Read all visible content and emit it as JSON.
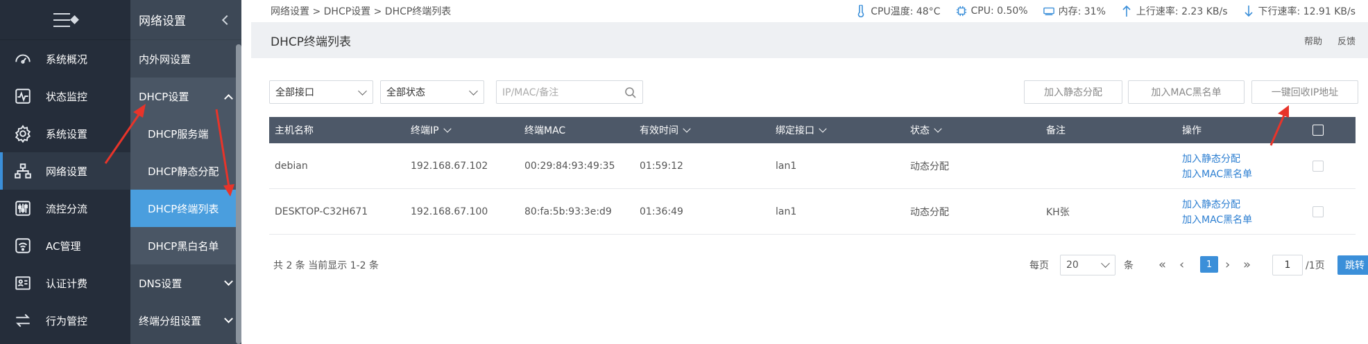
{
  "sidebar": {
    "items": [
      {
        "label": "系统概况",
        "icon": "dashboard-icon"
      },
      {
        "label": "状态监控",
        "icon": "pulse-icon"
      },
      {
        "label": "系统设置",
        "icon": "gear-icon"
      },
      {
        "label": "网络设置",
        "icon": "network-icon"
      },
      {
        "label": "流控分流",
        "icon": "sliders-icon"
      },
      {
        "label": "AC管理",
        "icon": "wifi-icon"
      },
      {
        "label": "认证计费",
        "icon": "id-card-icon"
      },
      {
        "label": "行为管控",
        "icon": "arrows-icon"
      }
    ]
  },
  "subnav": {
    "title": "网络设置",
    "items": [
      "内外网设置",
      "DHCP设置",
      "DNS设置",
      "终端分组设置"
    ],
    "children": [
      "DHCP服务端",
      "DHCP静态分配",
      "DHCP终端列表",
      "DHCP黑白名单"
    ]
  },
  "breadcrumb": "网络设置 > DHCP设置 > DHCP终端列表",
  "stats": {
    "cpu_temp": "CPU温度: 48°C",
    "cpu": "CPU: 0.50%",
    "mem": "内存: 31%",
    "up": "上行速率: 2.23 KB/s",
    "down": "下行速率: 12.91 KB/s"
  },
  "page": {
    "title": "DHCP终端列表",
    "help": "帮助",
    "feedback": "反馈"
  },
  "filters": {
    "iface": "全部接口",
    "status": "全部状态",
    "search_placeholder": "IP/MAC/备注"
  },
  "buttons": {
    "static": "加入静态分配",
    "blacklist": "加入MAC黑名单",
    "reclaim": "一键回收IP地址"
  },
  "table": {
    "headers": [
      "主机名称",
      "终端IP",
      "终端MAC",
      "有效时间",
      "绑定接口",
      "状态",
      "备注",
      "操作"
    ],
    "rows": [
      {
        "host": "debian",
        "ip": "192.168.67.102",
        "mac": "00:29:84:93:49:35",
        "ttl": "01:59:12",
        "iface": "lan1",
        "status": "动态分配",
        "note": "",
        "op1": "加入静态分配",
        "op2": "加入MAC黑名单"
      },
      {
        "host": "DESKTOP-C32H671",
        "ip": "192.168.67.100",
        "mac": "80:fa:5b:93:3e:d9",
        "ttl": "01:36:49",
        "iface": "lan1",
        "status": "动态分配",
        "note": "KH张",
        "op1": "加入静态分配",
        "op2": "加入MAC黑名单"
      }
    ]
  },
  "pager": {
    "summary": "共 2 条 当前显示 1-2 条",
    "per_page_label": "每页",
    "per_page": "20",
    "unit": "条",
    "current": "1",
    "page_input": "1",
    "total_pages": "/1页",
    "go": "跳转"
  },
  "colors": {
    "accent": "#3b8fd9",
    "sidebar": "#252d3a",
    "annotation": "#e8342a"
  }
}
